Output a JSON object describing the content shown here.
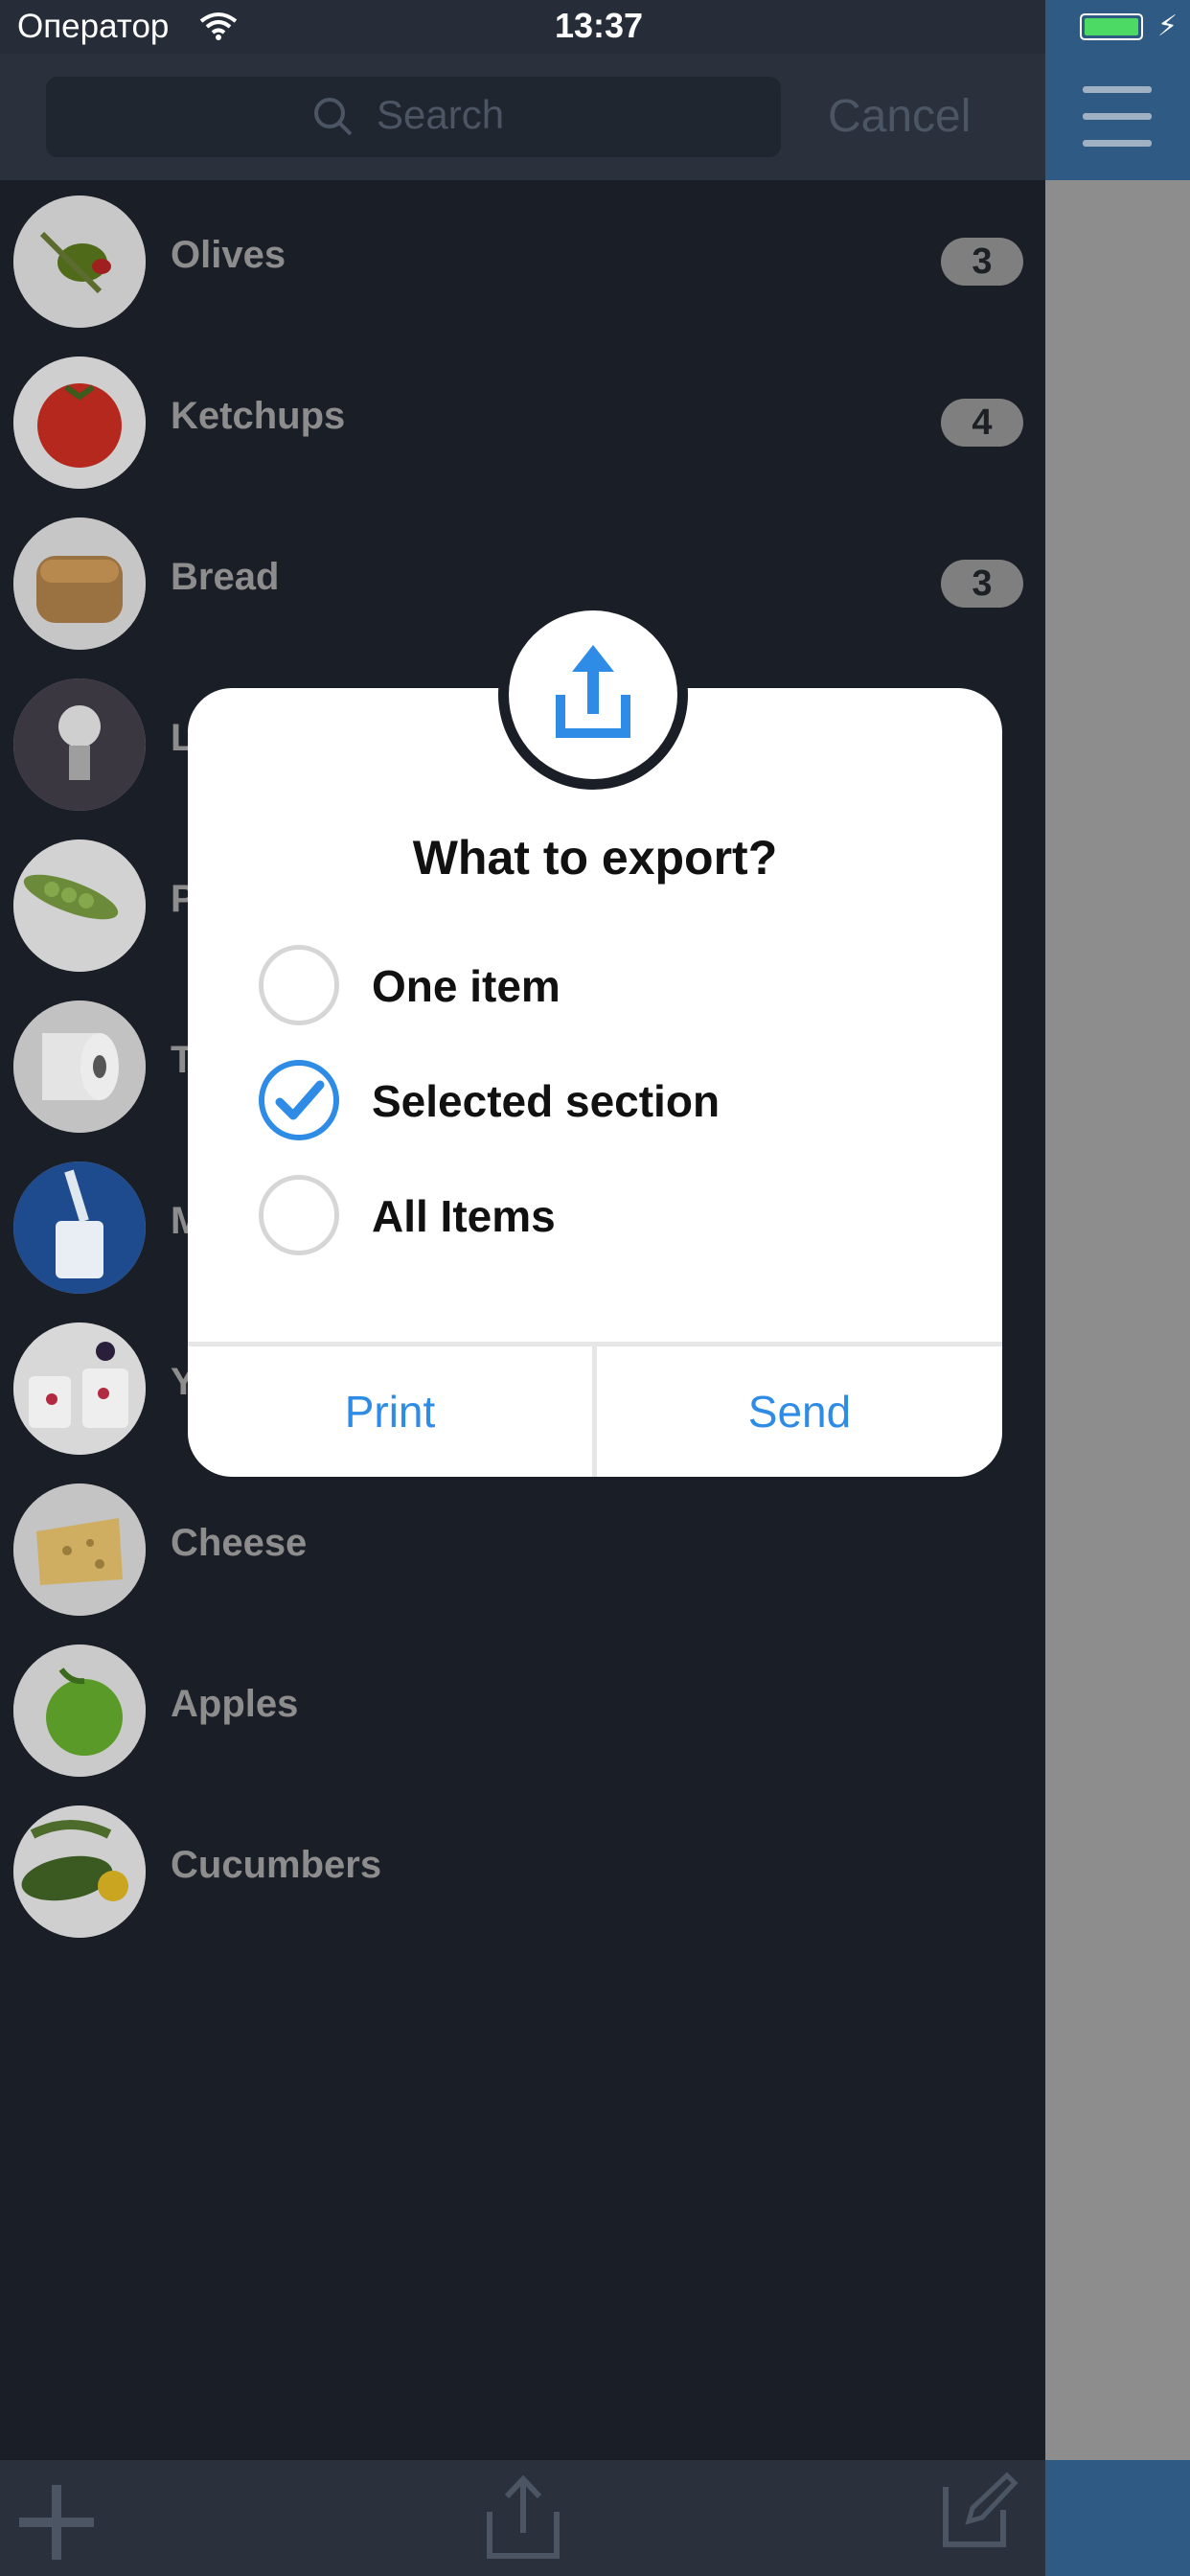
{
  "status_bar": {
    "carrier": "Оператор",
    "time": "13:37"
  },
  "search": {
    "placeholder": "Search",
    "cancel_label": "Cancel"
  },
  "items": [
    {
      "name": "Olives",
      "badge": "3",
      "icon": "olive-photo"
    },
    {
      "name": "Ketchups",
      "badge": "4",
      "icon": "tomato-photo"
    },
    {
      "name": "Bread",
      "badge": "3",
      "icon": "bread-photo"
    },
    {
      "name": "L",
      "badge": "",
      "icon": "light-bulb-photo"
    },
    {
      "name": "P",
      "badge": "",
      "icon": "peas-photo"
    },
    {
      "name": "T",
      "badge": "",
      "icon": "toilet-paper-photo"
    },
    {
      "name": "M",
      "badge": "",
      "icon": "milk-photo"
    },
    {
      "name": "Y",
      "badge": "",
      "icon": "yogurt-photo"
    },
    {
      "name": "Cheese",
      "badge": "",
      "icon": "cheese-photo"
    },
    {
      "name": "Apples",
      "badge": "",
      "icon": "apple-photo"
    },
    {
      "name": "Cucumbers",
      "badge": "",
      "icon": "cucumber-photo"
    }
  ],
  "dialog": {
    "title": "What to export?",
    "options": [
      {
        "label": "One item",
        "checked": false
      },
      {
        "label": "Selected section",
        "checked": true
      },
      {
        "label": "All Items",
        "checked": false
      }
    ],
    "print_label": "Print",
    "send_label": "Send"
  },
  "colors": {
    "accent": "#2f8ce6",
    "panel_blue": "#2e5a84",
    "list_background": "#1a1e26"
  }
}
